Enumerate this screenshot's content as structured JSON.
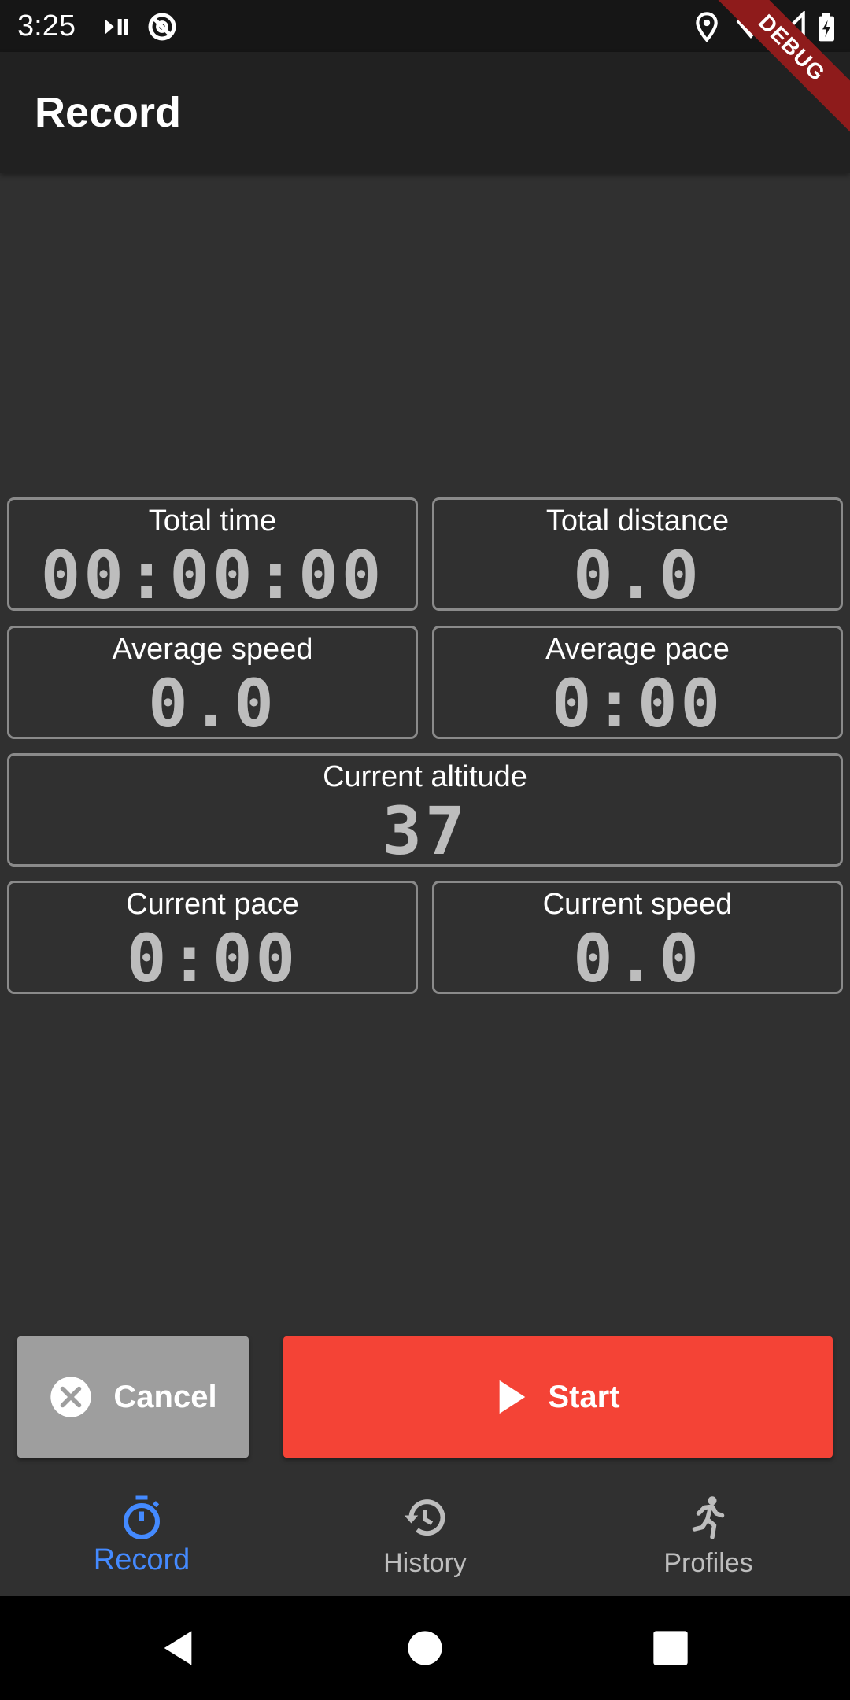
{
  "status_bar": {
    "time": "3:25"
  },
  "debug_banner": "DEBUG",
  "app_bar": {
    "title": "Record"
  },
  "metrics": {
    "total_time": {
      "label": "Total time",
      "value": "00:00:00"
    },
    "total_distance": {
      "label": "Total distance",
      "value": "0.0"
    },
    "average_speed": {
      "label": "Average speed",
      "value": "0.0"
    },
    "average_pace": {
      "label": "Average pace",
      "value": "0:00"
    },
    "current_altitude": {
      "label": "Current altitude",
      "value": "37"
    },
    "current_pace": {
      "label": "Current pace",
      "value": "0:00"
    },
    "current_speed": {
      "label": "Current speed",
      "value": "0.0"
    }
  },
  "actions": {
    "cancel_label": "Cancel",
    "start_label": "Start"
  },
  "bottom_nav": {
    "items": [
      {
        "label": "Record",
        "icon": "timer-icon",
        "active": true
      },
      {
        "label": "History",
        "icon": "history-icon",
        "active": false
      },
      {
        "label": "Profiles",
        "icon": "running-icon",
        "active": false
      }
    ]
  },
  "colors": {
    "background": "#303030",
    "app_bar": "#212121",
    "accent_active": "#448aff",
    "inactive_nav": "#bdbdbd",
    "start_button": "#f44336",
    "cancel_button": "#9e9e9e",
    "tile_border": "#8a8a8a",
    "value_text": "#bdbdbd"
  }
}
